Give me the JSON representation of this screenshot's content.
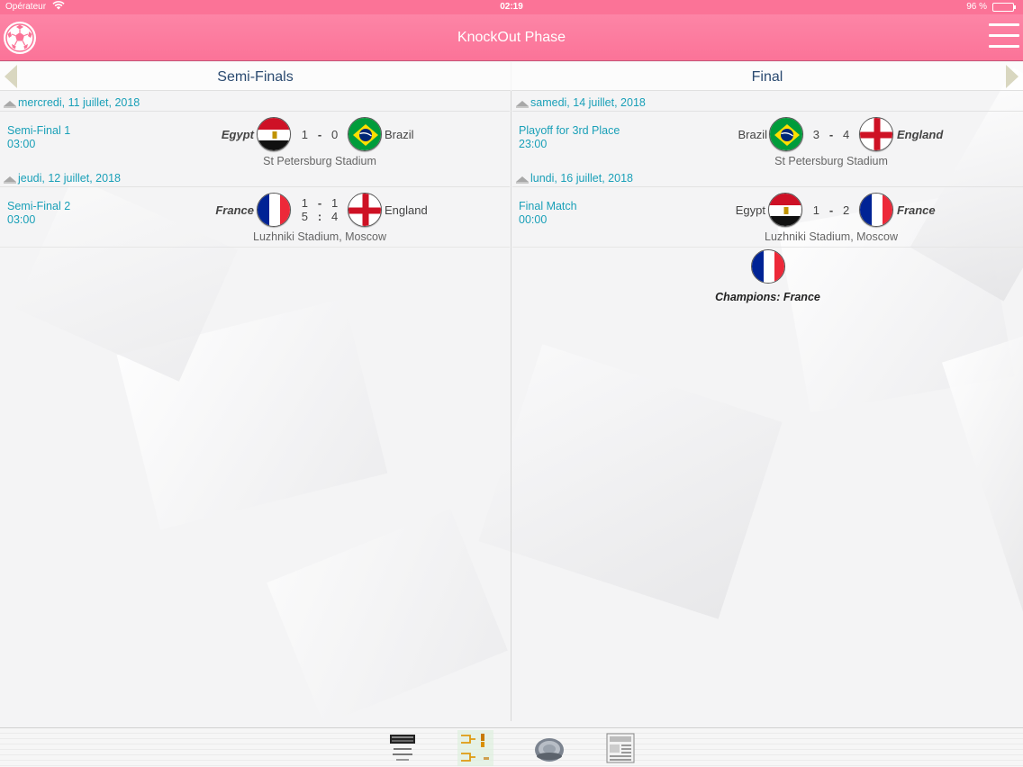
{
  "status_bar": {
    "carrier": "Opérateur",
    "time": "02:19",
    "battery": "96 %",
    "battery_level": 0.96
  },
  "nav": {
    "title": "KnockOut Phase",
    "left_icon": "soccer-ball-icon",
    "right_icon": "hamburger-menu-icon"
  },
  "columns": {
    "left_title": "Semi-Finals",
    "right_title": "Final"
  },
  "left": {
    "dates": [
      "mercredi, 11 juillet, 2018",
      "jeudi, 12 juillet, 2018"
    ],
    "matches": [
      {
        "name": "Semi-Final 1",
        "time": "03:00",
        "home": "Egypt",
        "away": "Brazil",
        "score_home": "1",
        "score_sep": "-",
        "score_away": "0",
        "stadium": "St Petersburg Stadium"
      },
      {
        "name": "Semi-Final 2",
        "time": "03:00",
        "home": "France",
        "away": "England",
        "score_home": "1",
        "score_sep": "-",
        "score_away": "1",
        "pen_home": "5",
        "pen_sep": ":",
        "pen_away": "4",
        "stadium": "Luzhniki Stadium, Moscow"
      }
    ]
  },
  "right": {
    "dates": [
      "samedi, 14 juillet, 2018",
      "lundi, 16 juillet, 2018"
    ],
    "matches": [
      {
        "name": "Playoff for 3rd Place",
        "time": "23:00",
        "home": "Brazil",
        "away": "England",
        "score_home": "3",
        "score_sep": "-",
        "score_away": "4",
        "stadium": "St Petersburg Stadium"
      },
      {
        "name": "Final Match",
        "time": "00:00",
        "home": "Egypt",
        "away": "France",
        "score_home": "1",
        "score_sep": "-",
        "score_away": "2",
        "stadium": "Luzhniki Stadium, Moscow"
      }
    ],
    "champion": "Champions: France"
  },
  "tabs": [
    {
      "icon": "winner-scoreboard-icon"
    },
    {
      "icon": "bracket-icon"
    },
    {
      "icon": "stadium-icon"
    },
    {
      "icon": "news-icon"
    }
  ],
  "colors": {
    "nav_pink": "#fb7397",
    "accent_teal": "#1aa0b8",
    "header_blue": "#2a4a70"
  }
}
